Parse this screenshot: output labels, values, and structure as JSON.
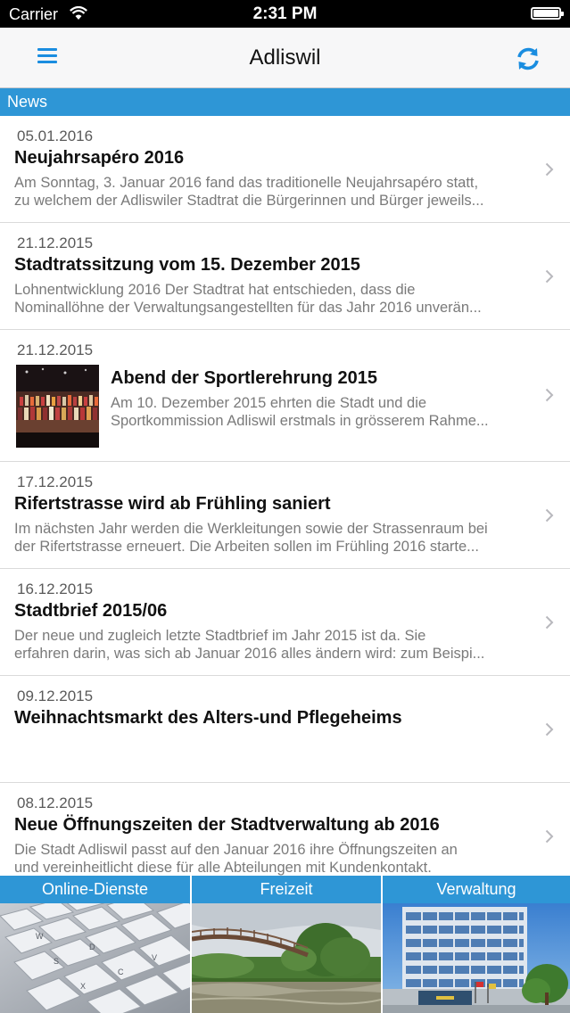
{
  "status_bar": {
    "carrier": "Carrier",
    "time": "2:31 PM"
  },
  "nav": {
    "title": "Adliswil",
    "menu_icon": "hamburger-menu-icon",
    "refresh_icon": "refresh-icon"
  },
  "section": {
    "title": "News"
  },
  "news": [
    {
      "date": "05.01.2016",
      "title": "Neujahrsapéro 2016",
      "teaser_1": "Am Sonntag, 3. Januar 2016 fand das traditionelle Neujahrsapéro statt,",
      "teaser_2": "zu welchem der Adliswiler Stadtrat die Bürgerinnen und Bürger jeweils..."
    },
    {
      "date": "21.12.2015",
      "title": "Stadtratssitzung vom 15. Dezember 2015",
      "teaser_1": "Lohnentwicklung 2016 Der Stadtrat hat entschieden, dass die",
      "teaser_2": "Nominallöhne der Verwaltungsangestellten für das Jahr 2016 unverän..."
    },
    {
      "date": "21.12.2015",
      "title": "Abend der Sportlerehrung 2015",
      "teaser_1": "Am 10. Dezember 2015 ehrten die Stadt und die",
      "teaser_2": "Sportkommission Adliswil erstmals in grösserem Rahme..."
    },
    {
      "date": "17.12.2015",
      "title": "Rifertstrasse wird ab Frühling saniert",
      "teaser_1": "Im nächsten Jahr werden die Werkleitungen sowie der Strassenraum bei",
      "teaser_2": "der Rifertstrasse erneuert. Die Arbeiten sollen im Frühling 2016 starte..."
    },
    {
      "date": "16.12.2015",
      "title": "Stadtbrief 2015/06",
      "teaser_1": "Der neue und zugleich letzte Stadtbrief im Jahr 2015 ist da. Sie",
      "teaser_2": "erfahren darin, was sich ab Januar 2016 alles ändern wird: zum Beispi..."
    },
    {
      "date": "09.12.2015",
      "title": "Weihnachtsmarkt des Alters-und Pflegeheims",
      "teaser_1": "",
      "teaser_2": ""
    },
    {
      "date": "08.12.2015",
      "title": "Neue Öffnungszeiten der Stadtverwaltung ab 2016",
      "teaser_1": "Die Stadt Adliswil passt auf den Januar 2016 ihre Öffnungszeiten an",
      "teaser_2": "und vereinheitlicht diese für alle Abteilungen mit Kundenkontakt."
    }
  ],
  "tiles": [
    {
      "label": "Online-Dienste"
    },
    {
      "label": "Freizeit"
    },
    {
      "label": "Verwaltung"
    }
  ],
  "colors": {
    "accent": "#2e96d6",
    "nav_icon": "#1a8de0"
  }
}
